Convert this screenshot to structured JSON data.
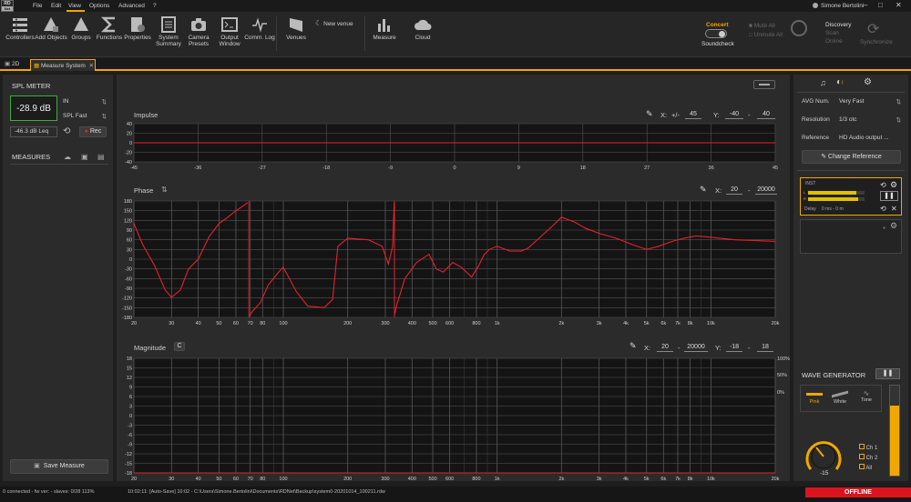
{
  "app": {
    "logo_top": "RD",
    "logo_bottom": "Net"
  },
  "menu": [
    "File",
    "Edit",
    "View",
    "Options",
    "Advanced",
    "?"
  ],
  "user": {
    "name": "Simone Bertolini"
  },
  "toolbar": {
    "items": [
      {
        "label": "Controllers",
        "icon": "controllers-icon"
      },
      {
        "label": "Add Objects",
        "icon": "add-objects-icon"
      },
      {
        "label": "Groups",
        "icon": "groups-icon"
      },
      {
        "label": "Functions",
        "icon": "sigma-icon"
      },
      {
        "label": "Properties",
        "icon": "properties-icon"
      },
      {
        "label": "System Summary",
        "icon": "system-summary-icon"
      },
      {
        "label": "Camera Presets",
        "icon": "camera-icon"
      },
      {
        "label": "Output Window",
        "icon": "output-window-icon"
      },
      {
        "label": "Comm. Log",
        "icon": "comm-log-icon"
      },
      {
        "label": "Venues",
        "icon": "venues-icon"
      },
      {
        "label": "New venue",
        "icon": "new-venue-icon"
      },
      {
        "label": "Measure",
        "icon": "measure-icon"
      },
      {
        "label": "Cloud",
        "icon": "cloud-icon"
      }
    ],
    "concert": "Concert",
    "soundcheck": "Soundcheck",
    "mute_all": "Mute All",
    "unmute_all": "Unmute All",
    "discovery": "Discovery",
    "scan": "Scan",
    "online": "Online",
    "synchronize": "Synchronize"
  },
  "tabs": [
    {
      "label": "2D",
      "active": false
    },
    {
      "label": "Measure System",
      "active": true
    }
  ],
  "spl_meter": {
    "title": "SPL METER",
    "value": "-28.9 dB",
    "input": "IN",
    "mode": "SPL Fast",
    "leq_value": "-46.3",
    "leq_label": "dB Leq",
    "rec": "Rec"
  },
  "measures": {
    "title": "MEASURES",
    "save": "Save Measure"
  },
  "impulse": {
    "title": "Impulse",
    "x_label": "X:",
    "x_pm": "+/-",
    "x_value": "45",
    "y_label": "Y:",
    "y_min": "-40",
    "y_max": "40",
    "y_ticks": [
      "40",
      "20",
      "0",
      "-20",
      "-40"
    ],
    "x_ticks": [
      "-45",
      "-36",
      "-27",
      "-18",
      "-9",
      "0",
      "9",
      "18",
      "27",
      "36",
      "45"
    ]
  },
  "phase": {
    "title": "Phase",
    "x_label": "X:",
    "x_min": "20",
    "x_max": "20000",
    "y_ticks": [
      "180",
      "150",
      "120",
      "90",
      "60",
      "30",
      "0",
      "-30",
      "-60",
      "-90",
      "-120",
      "-150",
      "-180"
    ],
    "x_ticks": [
      "20",
      "30",
      "40",
      "50",
      "60",
      "70",
      "80",
      "100",
      "200",
      "300",
      "400",
      "500",
      "600",
      "800",
      "1k",
      "2k",
      "3k",
      "4k",
      "5k",
      "6k",
      "7k",
      "8k",
      "10k",
      "20k"
    ]
  },
  "magnitude": {
    "title": "Magnitude",
    "c_button": "C",
    "x_label": "X:",
    "x_min": "20",
    "x_max": "20000",
    "y_label": "Y:",
    "y_min": "-18",
    "y_max": "18",
    "y_ticks": [
      "18",
      "15",
      "12",
      "9",
      "6",
      "3",
      "0",
      "-3",
      "-6",
      "-9",
      "-12",
      "-15",
      "-18"
    ],
    "right_ticks": [
      "100%",
      "50%",
      "0%"
    ],
    "x_ticks": [
      "20",
      "30",
      "40",
      "50",
      "60",
      "70",
      "80",
      "100",
      "200",
      "300",
      "400",
      "500",
      "600",
      "800",
      "1k",
      "2k",
      "3k",
      "4k",
      "5k",
      "6k",
      "7k",
      "8k",
      "10k",
      "20k"
    ]
  },
  "settings": {
    "avg_label": "AVG Num.",
    "avg_value": "Very Fast",
    "res_label": "Resolution",
    "res_value": "1/3 otc",
    "ref_label": "Reference",
    "ref_value": "HD Audio output ...",
    "change_ref": "Change Reference"
  },
  "channel": {
    "name": "INST",
    "left": "L",
    "right": "R",
    "delay_label": "Delay",
    "delay_value": "0",
    "delay_unit1": "ms",
    "delay_value2": "0",
    "delay_unit2": "m"
  },
  "wave_generator": {
    "title": "WAVE GENERATOR",
    "types": [
      "Pink",
      "White",
      "Tone"
    ],
    "level": "-15",
    "outputs": [
      "Ch 1",
      "Ch 2",
      "All"
    ]
  },
  "status": {
    "connected": "0 connected",
    "fw": "- fw ver:",
    "slaves": "- slaves: 0/28",
    "zoom": "113%",
    "message": "10:02:11: [Auto-Save] 10:02 - C:\\Users\\Simone.Bertolini\\Documents\\RDNet\\Backup\\system0-20201014_100211.rdw",
    "offline": "OFFLINE"
  },
  "colors": {
    "accent": "#f0a800",
    "curve": "#e8212b",
    "offline": "#d9141f",
    "meter_green": "#3fae3f"
  }
}
